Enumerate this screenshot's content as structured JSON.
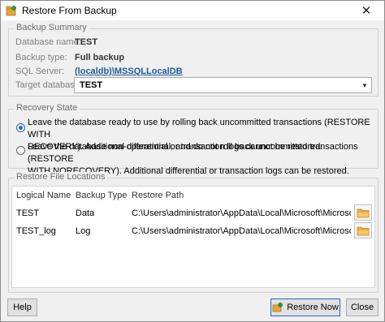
{
  "window": {
    "title": "Restore From Backup",
    "close_glyph": "✕"
  },
  "backup_summary": {
    "legend": "Backup Summary",
    "database_name_label": "Database name:",
    "database_name_value": "TEST",
    "backup_type_label": "Backup type:",
    "backup_type_value": "Full backup",
    "sql_server_label": "SQL Server:",
    "sql_server_value": "(localdb)\\MSSQLLocalDB",
    "target_database_label": "Target database:",
    "target_database_value": "TEST"
  },
  "recovery_state": {
    "legend": "Recovery State",
    "options": [
      {
        "line1": "Leave the database ready to use by rolling back uncommitted transactions (RESTORE WITH",
        "line2": "RECOVERY). Additional differential or transaction logs cannot be restored.",
        "selected": true
      },
      {
        "line1": "Leave the database non-operational, and do not roll back uncommitted transactions (RESTORE",
        "line2": "WITH NORECOVERY). Additional differential or transaction logs can be restored.",
        "selected": false
      }
    ]
  },
  "restore_files": {
    "legend": "Restore File Locations",
    "columns": [
      "Logical Name",
      "Backup Type",
      "Restore Path"
    ],
    "rows": [
      {
        "logical_name": "TEST",
        "backup_type": "Data",
        "restore_path": "C:\\Users\\administrator\\AppData\\Local\\Microsoft\\Microsoft S..."
      },
      {
        "logical_name": "TEST_log",
        "backup_type": "Log",
        "restore_path": "C:\\Users\\administrator\\AppData\\Local\\Microsoft\\Microsoft S..."
      }
    ]
  },
  "buttons": {
    "help": "Help",
    "restore_now": "Restore Now",
    "close": "Close"
  },
  "colors": {
    "accent": "#1e68c4",
    "link": "#1f5c99",
    "folder": "#e8a33a"
  }
}
